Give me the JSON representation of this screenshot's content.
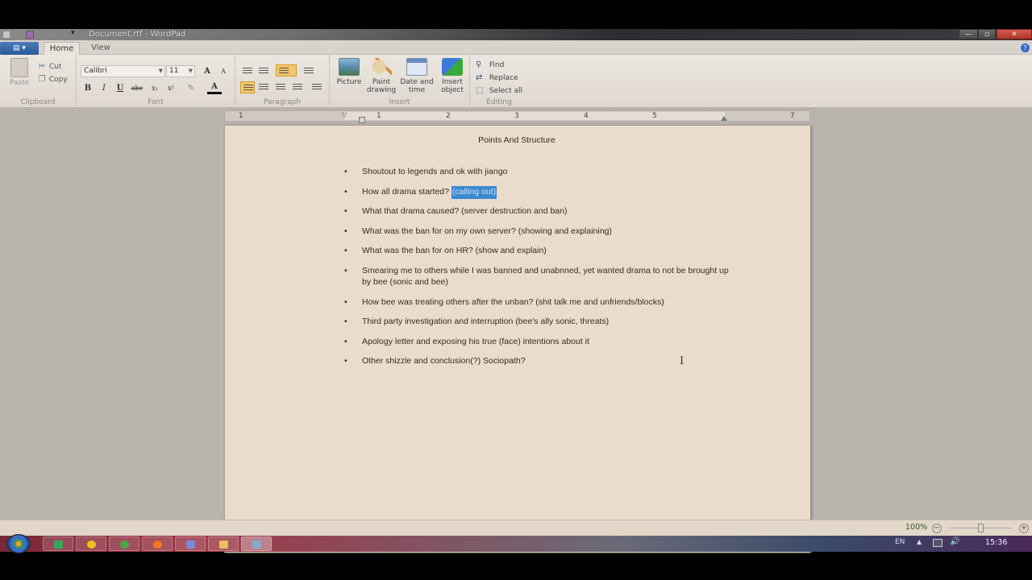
{
  "window": {
    "title": "Document.rtf - WordPad",
    "quick_access_dropdown": "▾",
    "minimize": "—",
    "maximize": "▫",
    "close": "✕",
    "help": "?"
  },
  "ribbon": {
    "app_menu": "▤ ▾",
    "tabs": [
      {
        "label": "Home",
        "active": true
      },
      {
        "label": "View",
        "active": false
      }
    ],
    "clipboard": {
      "label": "Clipboard",
      "paste": "Paste",
      "cut": "Cut",
      "copy": "Copy",
      "cut_icon": "✂",
      "copy_icon": "❐"
    },
    "font": {
      "label": "Font",
      "font_name": "Calibri",
      "font_size": "11",
      "grow": "A",
      "shrink": "A",
      "bold": "B",
      "italic": "I",
      "underline": "U",
      "strikethrough": "abc",
      "subscript": "x₂",
      "superscript": "x²",
      "highlight": "✎",
      "font_color": "A"
    },
    "paragraph": {
      "label": "Paragraph"
    },
    "insert": {
      "label": "Insert",
      "picture": "Picture",
      "paint_drawing_1": "Paint",
      "paint_drawing_2": "drawing",
      "date_time_1": "Date and",
      "date_time_2": "time",
      "insert_object_1": "Insert",
      "insert_object_2": "object"
    },
    "editing": {
      "label": "Editing",
      "find": "Find",
      "replace": "Replace",
      "select_all": "Select all",
      "find_icon": "⚲",
      "replace_icon": "⇄",
      "select_all_icon": "⬚"
    }
  },
  "ruler": {
    "numbers": [
      "1",
      "1",
      "2",
      "3",
      "4",
      "5",
      "7"
    ]
  },
  "document": {
    "title": "Points And Structure",
    "bullet": "•",
    "items": [
      {
        "text": "Shoutout to legends and ok with jiango",
        "selected": ""
      },
      {
        "text": "How all drama started? ",
        "selected": "(calling out)"
      },
      {
        "text": "What that drama caused? (server destruction and ban)",
        "selected": ""
      },
      {
        "text": "What was the ban for on my own server? (showing and explaining)",
        "selected": ""
      },
      {
        "text": "What was the ban for on HR? (show and explain)",
        "selected": ""
      },
      {
        "text": "Smearing me to others while I was banned and unabnned, yet wanted drama to not be brought up by bee (sonic and bee)",
        "selected": ""
      },
      {
        "text": "How bee was treating others after the unban? (shit talk me and unfriends/blocks)",
        "selected": ""
      },
      {
        "text": "Third party investigation and interruption (bee's ally sonic, threats)",
        "selected": ""
      },
      {
        "text": "Apology letter and exposing his true (face) intentions about it",
        "selected": ""
      },
      {
        "text": "Other shizzle and conclusion(?) Sociopath?",
        "selected": ""
      }
    ],
    "text_cursor": "I"
  },
  "statusbar": {
    "zoom_level": "100%",
    "zoom_percent": 100,
    "zoom_out": "−",
    "zoom_in": "+"
  },
  "taskbar": {
    "language": "EN",
    "show_hidden": "▲",
    "volume": "🔊",
    "clock": "15:36",
    "apps": [
      "app-1",
      "app-2",
      "utorrent",
      "firefox",
      "app-5",
      "explorer",
      "wordpad"
    ]
  }
}
